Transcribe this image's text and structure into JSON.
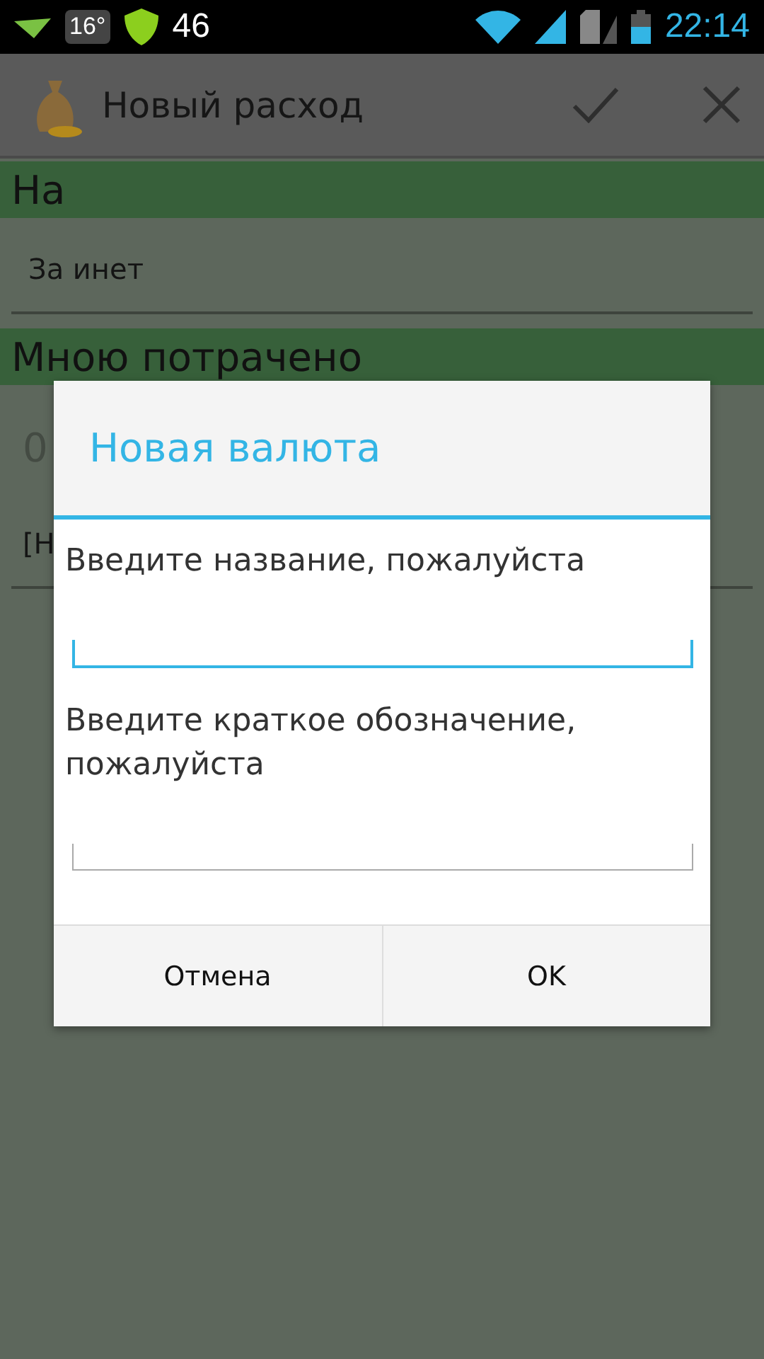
{
  "status_bar": {
    "temperature": "16°",
    "notification_count": "46",
    "time": "22:14"
  },
  "action_bar": {
    "title": "Новый расход"
  },
  "form": {
    "sections": [
      {
        "header": "На",
        "kind": "spinner",
        "value": "За инет"
      },
      {
        "header": "Мною потрачено",
        "kind": "amount",
        "value": "0"
      }
    ],
    "spinner_value": "[Н"
  },
  "dialog": {
    "title": "Новая валюта",
    "fields": [
      {
        "label": "Введите название, пожалуйста",
        "focused": true
      },
      {
        "label": "Введите краткое обозначение, пожалуйста",
        "focused": false
      }
    ],
    "buttons": [
      "Отмена",
      "OK"
    ]
  }
}
